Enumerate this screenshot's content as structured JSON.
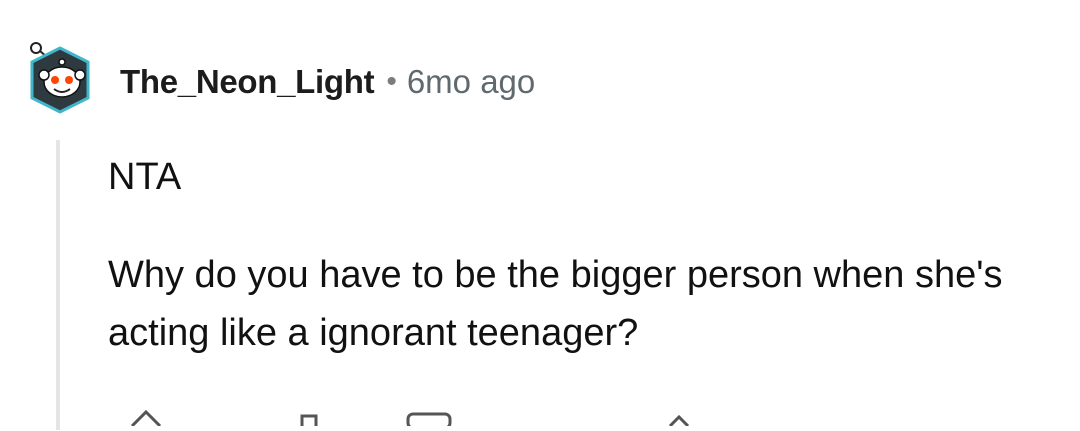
{
  "comment": {
    "username": "The_Neon_Light",
    "separator": "•",
    "timestamp": "6mo ago",
    "body": [
      "NTA",
      "Why do you have to be the bigger person when she's acting like a ignorant teenager?"
    ],
    "avatar_icon": "snoo-avatar-icon",
    "actions": [
      {
        "icon": "upvote-icon"
      },
      {
        "icon": "downvote-icon"
      },
      {
        "icon": "reply-icon"
      },
      {
        "icon": "award-icon"
      }
    ]
  }
}
